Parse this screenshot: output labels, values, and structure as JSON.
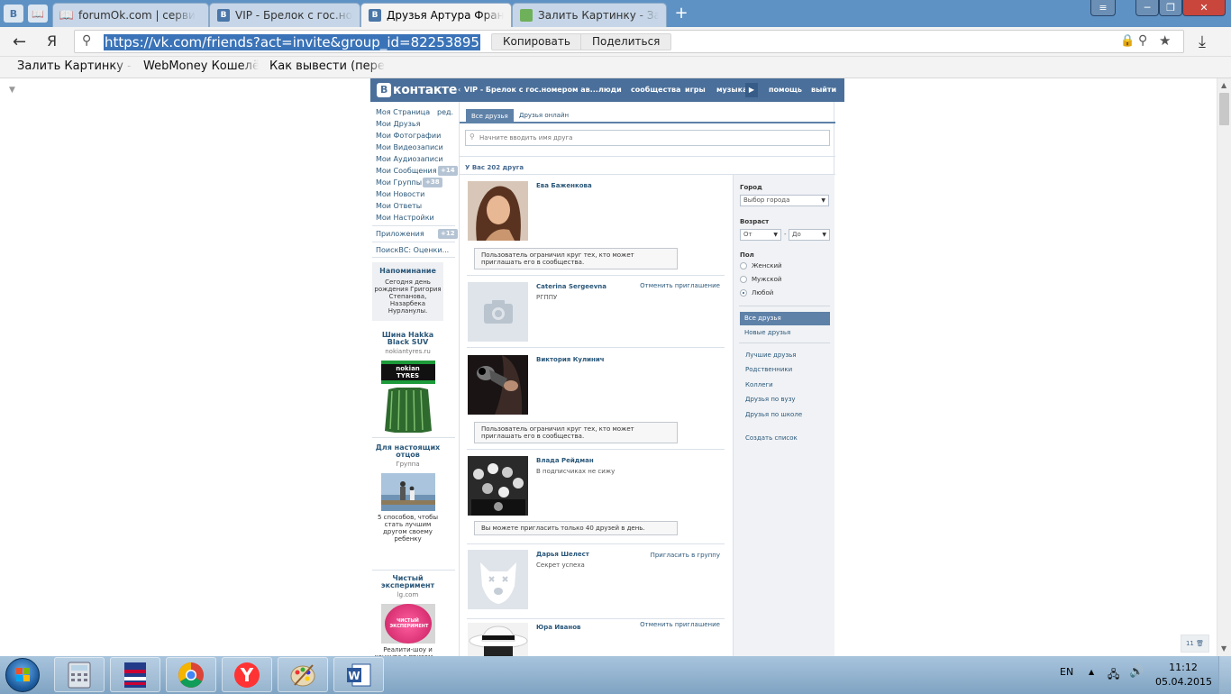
{
  "browser": {
    "tabs": [
      {
        "label": "forumOk.com | серви",
        "icon": "book-icon"
      },
      {
        "label": "VIP - Брелок с гос.ном",
        "icon": "vk-icon"
      },
      {
        "label": "Друзья Артура Франк",
        "icon": "vk-icon"
      },
      {
        "label": "Залить Картинку - За",
        "icon": "picture-icon"
      }
    ],
    "pinned": [
      "В",
      "📖"
    ],
    "window": {
      "minimize": "─",
      "maximize": "❐",
      "close": "✕"
    },
    "back": "←",
    "logo": "Я",
    "url": "https://vk.com/friends?act=invite&group_id=82253895",
    "copy_button": "Копировать",
    "share_button": "Поделиться",
    "bookmarks": [
      "Залить Картинку - З",
      "WebMoney Кошелё",
      "Как вывести (переве"
    ]
  },
  "vk": {
    "logo": "контакте",
    "logo_b": "В",
    "group_link": "VIP - Брелок с гос.номером ав...",
    "nav": [
      "люди",
      "сообщества",
      "игры",
      "музыка",
      "помощь",
      "выйти"
    ],
    "menu": [
      {
        "label": "Моя Страница",
        "extra": "ред."
      },
      {
        "label": "Мои Друзья"
      },
      {
        "label": "Мои Фотографии"
      },
      {
        "label": "Мои Видеозаписи"
      },
      {
        "label": "Мои Аудиозаписи"
      },
      {
        "label": "Мои Сообщения",
        "badge": "+14"
      },
      {
        "label": "Мои Группы",
        "badge": "+38"
      },
      {
        "label": "Мои Новости"
      },
      {
        "label": "Мои Ответы"
      },
      {
        "label": "Мои Настройки"
      }
    ],
    "apps": {
      "label": "Приложения",
      "badge": "+12"
    },
    "app_item": "ПоискВС: Оценки...",
    "reminder": {
      "title": "Напоминание",
      "text": "Сегодня день рождения Григория Степанова, Назарбека Нурланулы."
    },
    "ads": [
      {
        "title": "Шина Hakka Black SUV",
        "site": "nokiantyres.ru",
        "desc": "",
        "logo": "nokian TYRES"
      },
      {
        "title": "Для настоящих отцов",
        "site": "Группа",
        "desc": "5 способов, чтобы стать лучшим другом своему ребенку"
      },
      {
        "title": "Чистый эксперимент",
        "site": "lg.com",
        "desc": "Реалити-шоу и конкурс с призом — стиральной машиной от LG",
        "logo": "ЧИСТЫЙ ЭКСПЕРИМЕНТ"
      }
    ],
    "tabs": {
      "all": "Все друзья",
      "online": "Друзья онлайн"
    },
    "search_placeholder": "Начните вводить имя друга",
    "count": "У Вас 202 друга",
    "friends": [
      {
        "name": "Ева Баженкова",
        "sub": "",
        "link": "",
        "msg": "Пользователь ограничил круг тех, кто может приглашать его в сообщества.",
        "photo": "portrait"
      },
      {
        "name": "Caterina Sergeevna",
        "sub": "РГППУ",
        "link": "Отменить приглашение",
        "msg": "",
        "photo": "camera"
      },
      {
        "name": "Виктория Кулинич",
        "sub": "",
        "link": "",
        "msg": "Пользователь ограничил круг тех, кто может приглашать его в сообщества.",
        "photo": "gun"
      },
      {
        "name": "Влада Рейдман",
        "sub": "В подписчиках не сижу",
        "link": "",
        "msg": "Вы можете пригласить только 40 друзей в день.",
        "photo": "band"
      },
      {
        "name": "Дарья Шелест",
        "sub": "Секрет успеха",
        "link": "Пригласить в группу",
        "msg": "",
        "photo": "deleted"
      },
      {
        "name": "Юра Иванов",
        "sub": "",
        "link": "Отменить приглашение",
        "msg": "",
        "photo": "hat"
      }
    ],
    "filter": {
      "city_label": "Город",
      "city_select": "Выбор города",
      "age_label": "Возраст",
      "age_from": "От",
      "age_dash": "-",
      "age_to": "До",
      "sex_label": "Пол",
      "sex": [
        "Женский",
        "Мужской",
        "Любой"
      ],
      "lists": [
        "Все друзья",
        "Новые друзья",
        "Лучшие друзья",
        "Родственники",
        "Коллеги",
        "Друзья по вузу",
        "Друзья по школе",
        "Создать список"
      ]
    },
    "pager": "11"
  },
  "taskbar": {
    "lang": "EN",
    "time": "11:12",
    "date": "05.04.2015"
  },
  "colors": {
    "vk_blue": "#4a6f9a",
    "link": "#2b587a",
    "tab_accent": "#5e81a8",
    "url_select": "#3a73b8"
  }
}
